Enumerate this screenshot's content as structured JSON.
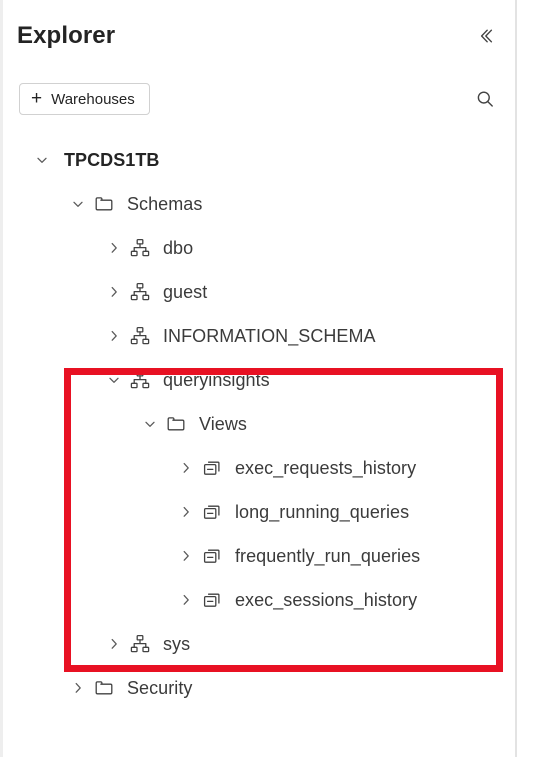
{
  "header": {
    "title": "Explorer",
    "collapse_icon": "double-chevron-left-icon"
  },
  "toolbar": {
    "warehouses_label": "Warehouses",
    "warehouses_plus": "+",
    "search_icon": "search-icon"
  },
  "annotation": {
    "color": "#e81123",
    "shape": "rectangle"
  },
  "tree": {
    "items": [
      {
        "label": "TPCDS1TB",
        "level": 0,
        "chevron": "down",
        "icon": "none",
        "bold": true
      },
      {
        "label": "Schemas",
        "level": 1,
        "chevron": "down",
        "icon": "folder",
        "bold": false
      },
      {
        "label": "dbo",
        "level": 2,
        "chevron": "right",
        "icon": "schema",
        "bold": false
      },
      {
        "label": "guest",
        "level": 2,
        "chevron": "right",
        "icon": "schema",
        "bold": false
      },
      {
        "label": "INFORMATION_SCHEMA",
        "level": 2,
        "chevron": "right",
        "icon": "schema",
        "bold": false
      },
      {
        "label": "queryinsights",
        "level": 2,
        "chevron": "down",
        "icon": "schema",
        "bold": false
      },
      {
        "label": "Views",
        "level": 3,
        "chevron": "down",
        "icon": "folder",
        "bold": false
      },
      {
        "label": "exec_requests_history",
        "level": 4,
        "chevron": "right",
        "icon": "view",
        "bold": false
      },
      {
        "label": "long_running_queries",
        "level": 4,
        "chevron": "right",
        "icon": "view",
        "bold": false
      },
      {
        "label": "frequently_run_queries",
        "level": 4,
        "chevron": "right",
        "icon": "view",
        "bold": false
      },
      {
        "label": "exec_sessions_history",
        "level": 4,
        "chevron": "right",
        "icon": "view",
        "bold": false
      },
      {
        "label": "sys",
        "level": 2,
        "chevron": "right",
        "icon": "schema",
        "bold": false
      },
      {
        "label": "Security",
        "level": 1,
        "chevron": "right",
        "icon": "folder",
        "bold": false
      }
    ]
  }
}
